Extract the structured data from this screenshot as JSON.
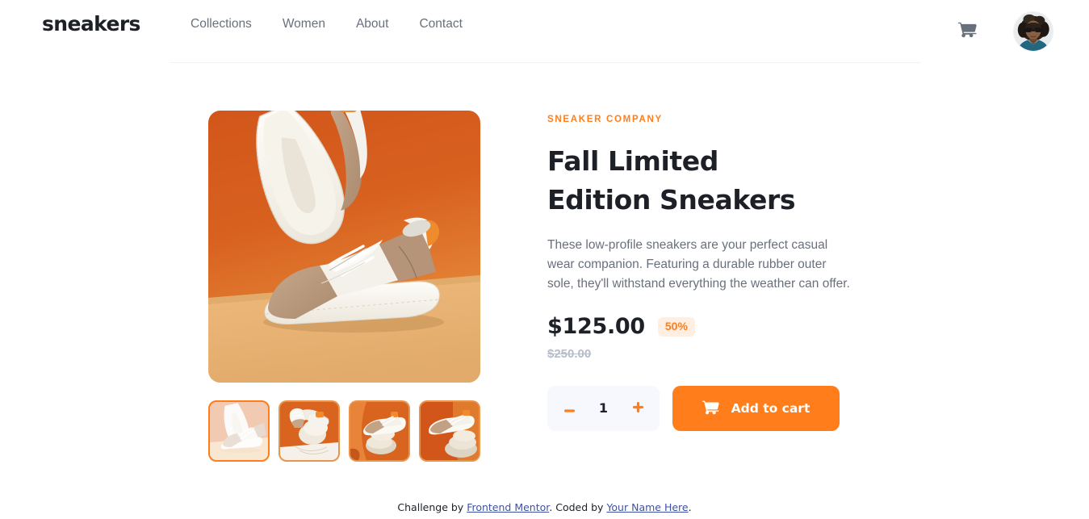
{
  "header": {
    "logo": "sneakers",
    "nav": [
      {
        "label": "Collections"
      },
      {
        "label": "Women"
      },
      {
        "label": "About"
      },
      {
        "label": "Contact"
      }
    ],
    "cart_icon": "shopping-cart-icon",
    "avatar_alt": "user-avatar"
  },
  "gallery": {
    "main_image_alt": "product-image-1",
    "thumbnails": [
      {
        "alt": "product-thumbnail-1",
        "selected": true
      },
      {
        "alt": "product-thumbnail-2",
        "selected": false
      },
      {
        "alt": "product-thumbnail-3",
        "selected": false
      },
      {
        "alt": "product-thumbnail-4",
        "selected": false
      }
    ]
  },
  "product": {
    "company": "SNEAKER COMPANY",
    "title": "Fall Limited Edition Sneakers",
    "description": "These low-profile sneakers are your perfect casual wear companion. Featuring a durable rubber outer sole, they'll withstand everything the weather can offer.",
    "price_current": "$125.00",
    "discount_badge": "50%",
    "price_original": "$250.00",
    "quantity": "1",
    "decrease_label": "minus-icon",
    "increase_label": "plus-icon",
    "add_to_cart_label": "Add to cart"
  },
  "footer": {
    "prefix": "Challenge by ",
    "link1": "Frontend Mentor",
    "middle": ". Coded by ",
    "link2": "Your Name Here",
    "suffix": "."
  },
  "colors": {
    "accent_orange": "#ff7e1b",
    "pale_orange": "#ffeee2",
    "dark_blue": "#1d2026",
    "grayish_blue": "#69707d",
    "light_grayish_blue": "#f6f8fd",
    "divider": "#f0f1fa",
    "link_blue": "#3e52a3"
  }
}
